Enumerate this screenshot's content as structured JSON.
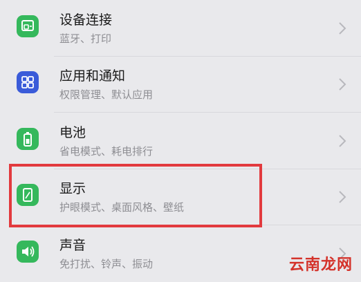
{
  "settings": {
    "items": [
      {
        "title": "设备连接",
        "subtitle": "蓝牙、打印",
        "icon": "device-connection-icon",
        "icon_color": "#35b85c"
      },
      {
        "title": "应用和通知",
        "subtitle": "权限管理、默认应用",
        "icon": "apps-grid-icon",
        "icon_color": "#3a5bd9"
      },
      {
        "title": "电池",
        "subtitle": "省电模式、耗电排行",
        "icon": "battery-icon",
        "icon_color": "#35b85c"
      },
      {
        "title": "显示",
        "subtitle": "护眼模式、桌面风格、壁纸",
        "icon": "display-icon",
        "icon_color": "#35b85c"
      },
      {
        "title": "声音",
        "subtitle": "免打扰、铃声、振动",
        "icon": "speaker-icon",
        "icon_color": "#35b85c"
      }
    ],
    "highlight_color": "#e23a3e"
  },
  "watermark": {
    "text": "云南龙网"
  }
}
